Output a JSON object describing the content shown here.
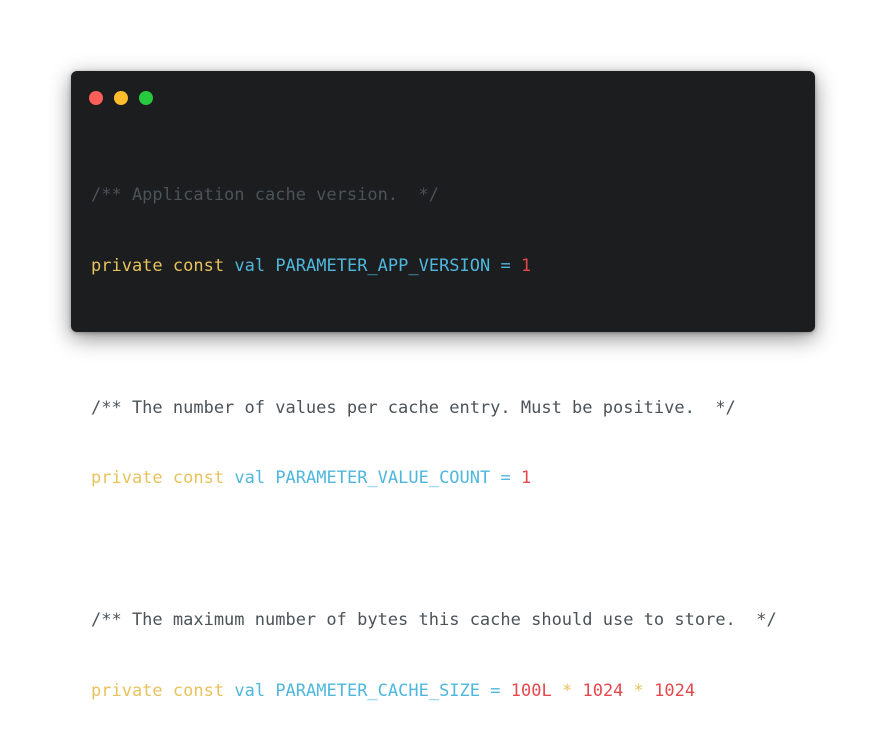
{
  "window_controls": {
    "close_color": "#ff5f56",
    "minimize_color": "#ffbd2e",
    "maximize_color": "#27c93f"
  },
  "code": {
    "line1": {
      "comment": "/** Application cache version.  */"
    },
    "line2": {
      "kw1": "private",
      "kw2": "const",
      "decl": "val",
      "name": "PARAMETER_APP_VERSION",
      "op": "=",
      "value": "1"
    },
    "line4": {
      "comment": "/** The number of values per cache entry. Must be positive.  */"
    },
    "line5": {
      "kw1": "private",
      "kw2": "const",
      "decl": "val",
      "name": "PARAMETER_VALUE_COUNT",
      "op": "=",
      "value": "1"
    },
    "line7": {
      "comment": "/** The maximum number of bytes this cache should use to store.  */"
    },
    "line8": {
      "kw1": "private",
      "kw2": "const",
      "decl": "val",
      "name": "PARAMETER_CACHE_SIZE",
      "op": "=",
      "v1": "100L",
      "star1": "*",
      "v2": "1024",
      "star2": "*",
      "v3": "1024"
    }
  }
}
